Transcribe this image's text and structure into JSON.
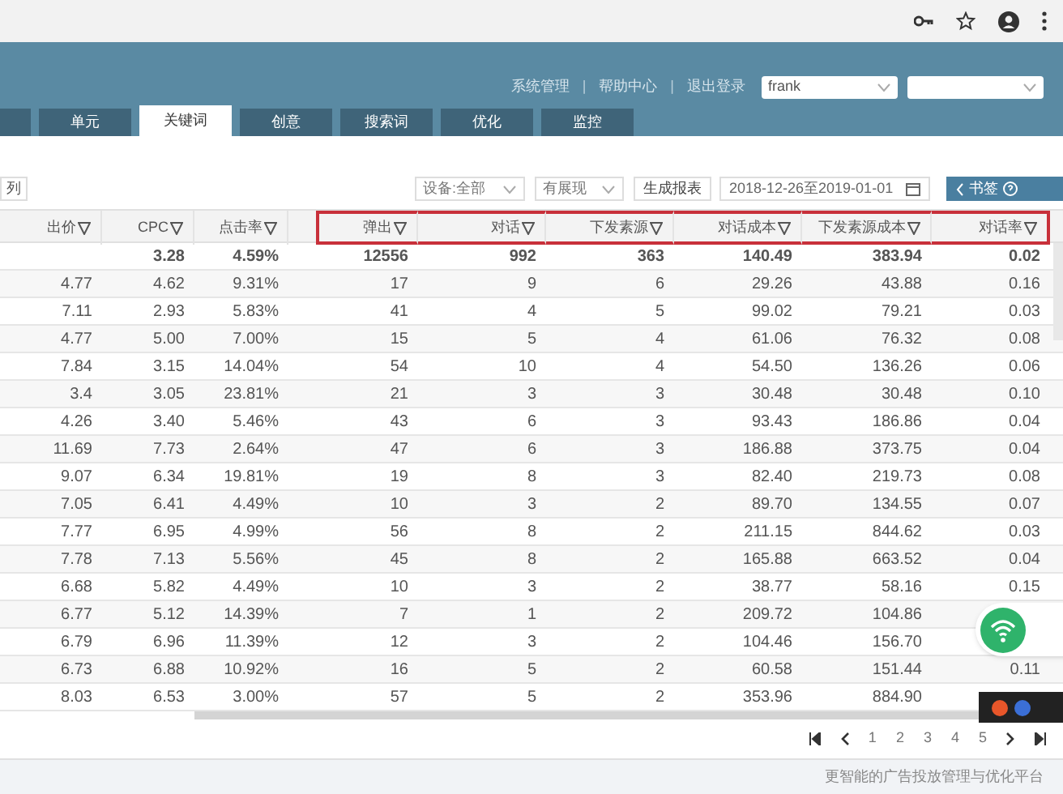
{
  "header": {
    "links": [
      {
        "kind": "link",
        "text": "系统管理"
      },
      {
        "kind": "separator",
        "text": "|"
      },
      {
        "kind": "link",
        "text": "帮助中心"
      },
      {
        "kind": "separator",
        "text": "|"
      },
      {
        "kind": "link",
        "text": "退出登录"
      }
    ],
    "user_select": "frank"
  },
  "tabs": [
    {
      "selected": false
    },
    {
      "label": "单元",
      "selected": false
    },
    {
      "label": "关键词",
      "selected": true
    },
    {
      "label": "创意",
      "selected": false
    },
    {
      "label": "搜索词",
      "selected": false
    },
    {
      "label": "优化",
      "selected": false
    },
    {
      "label": "监控",
      "selected": false
    }
  ],
  "toolbar": {
    "columns_button": "列",
    "device_select": "设备:全部",
    "display_select": "有展现",
    "report_button": "生成报表",
    "date_range": "2018-12-26至2019-01-01",
    "bookmark_button": "书签"
  },
  "table": {
    "columns": [
      {
        "label": "出价",
        "highlighted": false
      },
      {
        "label": "CPC",
        "highlighted": false
      },
      {
        "label": "点击率",
        "highlighted": false
      },
      {
        "label": "弹出",
        "highlighted": true
      },
      {
        "label": "对话",
        "highlighted": true
      },
      {
        "label": "下发素源",
        "highlighted": true
      },
      {
        "label": "对话成本",
        "highlighted": true
      },
      {
        "label": "下发素源成本",
        "highlighted": true
      },
      {
        "label": "对话率",
        "highlighted": true
      }
    ],
    "total": [
      "3.28",
      "4.59%",
      "12556",
      "992",
      "363",
      "140.49",
      "383.94",
      "0.02"
    ],
    "rows": [
      [
        "4.77",
        "4.62",
        "9.31%",
        "17",
        "9",
        "6",
        "29.26",
        "43.88",
        "0.16"
      ],
      [
        "7.11",
        "2.93",
        "5.83%",
        "41",
        "4",
        "5",
        "99.02",
        "79.21",
        "0.03"
      ],
      [
        "4.77",
        "5.00",
        "7.00%",
        "15",
        "5",
        "4",
        "61.06",
        "76.32",
        "0.08"
      ],
      [
        "7.84",
        "3.15",
        "14.04%",
        "54",
        "10",
        "4",
        "54.50",
        "136.26",
        "0.06"
      ],
      [
        "3.4",
        "3.05",
        "23.81%",
        "21",
        "3",
        "3",
        "30.48",
        "30.48",
        "0.10"
      ],
      [
        "4.26",
        "3.40",
        "5.46%",
        "43",
        "6",
        "3",
        "93.43",
        "186.86",
        "0.04"
      ],
      [
        "11.69",
        "7.73",
        "2.64%",
        "47",
        "6",
        "3",
        "186.88",
        "373.75",
        "0.04"
      ],
      [
        "9.07",
        "6.34",
        "19.81%",
        "19",
        "8",
        "3",
        "82.40",
        "219.73",
        "0.08"
      ],
      [
        "7.05",
        "6.41",
        "4.49%",
        "10",
        "3",
        "2",
        "89.70",
        "134.55",
        "0.07"
      ],
      [
        "7.77",
        "6.95",
        "4.99%",
        "56",
        "8",
        "2",
        "211.15",
        "844.62",
        "0.03"
      ],
      [
        "7.78",
        "7.13",
        "5.56%",
        "45",
        "8",
        "2",
        "165.88",
        "663.52",
        "0.04"
      ],
      [
        "6.68",
        "5.82",
        "4.49%",
        "10",
        "3",
        "2",
        "38.77",
        "58.16",
        "0.15"
      ],
      [
        "6.77",
        "5.12",
        "14.39%",
        "7",
        "1",
        "2",
        "209.72",
        "104.86"
      ],
      [
        "6.79",
        "6.96",
        "11.39%",
        "12",
        "3",
        "2",
        "104.46",
        "156.70"
      ],
      [
        "6.73",
        "6.88",
        "10.92%",
        "16",
        "5",
        "2",
        "60.58",
        "151.44",
        "0.11"
      ],
      [
        "8.03",
        "6.53",
        "3.00%",
        "57",
        "5",
        "2",
        "353.96",
        "884.90"
      ]
    ]
  },
  "pagination": {
    "pages": [
      "1",
      "2",
      "3",
      "4",
      "5"
    ]
  },
  "footer": "更智能的广告投放管理与优化平台"
}
